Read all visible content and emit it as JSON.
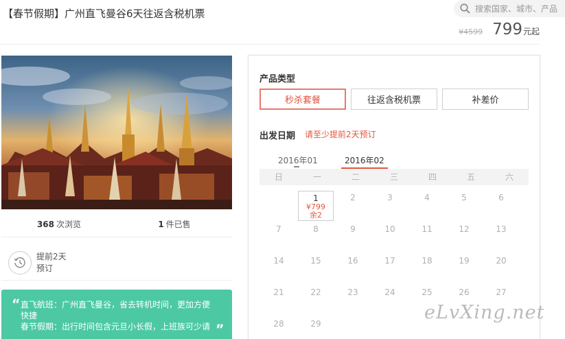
{
  "header": {
    "title": "【春节假期】广州直飞曼谷6天往返含税机票",
    "search_placeholder": "搜索国家、城市、产品",
    "price_original": "¥4599",
    "price_current": "799",
    "price_unit": "元起"
  },
  "stats": {
    "views_count": "368",
    "views_label": "次浏览",
    "sold_count": "1",
    "sold_label": "件已售"
  },
  "advance": {
    "line1": "提前2天",
    "line2": "预订"
  },
  "highlights": {
    "line1": "直飞航班：广州直飞曼谷，省去转机时间，更加方便",
    "line2": "快捷",
    "line3": "春节假期：出行时间包含元旦小长假，上班族可少请"
  },
  "booking": {
    "product_type_label": "产品类型",
    "product_types": [
      "秒杀套餐",
      "往返含税机票",
      "补差价"
    ],
    "departure_label": "出发日期",
    "departure_note": "请至少提前2天预订",
    "months": [
      "2016年01",
      "2016年02"
    ],
    "weekdays": [
      "日",
      "一",
      "二",
      "三",
      "四",
      "五",
      "六"
    ],
    "calendar_days": [
      "1",
      "2",
      "3",
      "4",
      "5",
      "6",
      "7",
      "8",
      "9",
      "10",
      "11",
      "12",
      "13",
      "14",
      "15",
      "16",
      "17",
      "18",
      "19",
      "20",
      "21",
      "22",
      "23",
      "24",
      "25",
      "26",
      "27",
      "28",
      "29"
    ],
    "selected_day": {
      "day": "1",
      "price": "¥799",
      "remaining": "余2"
    }
  },
  "watermark": "eLvXing.net",
  "colors": {
    "accent_red": "#e4563c",
    "green_box": "#4cc9a3"
  }
}
